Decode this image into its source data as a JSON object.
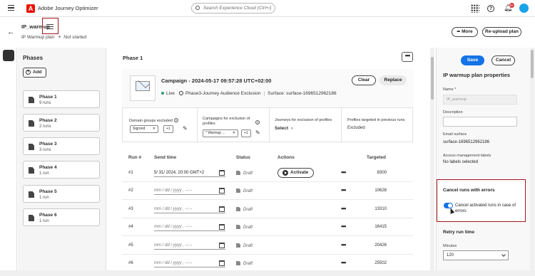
{
  "topbar": {
    "app_name": "Adobe Journey Optimizer",
    "search_placeholder": "Search Experience Cloud (Ctrl+/)",
    "notification_count": "9+",
    "brand_color": "#eb1000"
  },
  "header": {
    "title": "IP_warmup",
    "plan_label": "IP Warmup plan",
    "status": "Not started",
    "more_label": "More",
    "reupload_label": "Re-upload plan"
  },
  "phases_panel": {
    "title": "Phases",
    "add_label": "Add",
    "items": [
      {
        "name": "Phase 1",
        "runs": "9 runs"
      },
      {
        "name": "Phase 2",
        "runs": "2 runs"
      },
      {
        "name": "Phase 3",
        "runs": "3 runs"
      },
      {
        "name": "Phase 4",
        "runs": "1 run"
      },
      {
        "name": "Phase 5",
        "runs": "1 run"
      },
      {
        "name": "Phase 6",
        "runs": "1 run"
      }
    ]
  },
  "phase": {
    "title": "Phase 1",
    "campaign": {
      "name": "Campaign - 2024-05-17 09:57:28 UTC+02:00",
      "status": "Live",
      "audience": "Phase3-Journey Audience Exclusion",
      "surface": "Surface: surface-1696512962186",
      "clear_label": "Clear",
      "replace_label": "Replace"
    },
    "exclusions": {
      "domain_groups_label": "Domain groups excluded",
      "domain_tag": "Sigrond",
      "domain_more": "+1",
      "campaigns_label": "Campaigns for exclusion of profiles",
      "campaign_tag": "* Warmup ...",
      "campaign_more": "+1",
      "journeys_label": "Journeys for exclusion of profiles",
      "journeys_value": "Select",
      "profiles_label": "Profiles targeted in previous runs",
      "profiles_value": "Excluded"
    },
    "table": {
      "headers": {
        "run": "Run #",
        "send_time": "Send time",
        "status": "Status",
        "actions": "Actions",
        "targeted": "Targeted"
      },
      "activate_label": "Activate",
      "rows": [
        {
          "run": "#1",
          "send_time": "5/ 31/ 2024, 20:00 GMT+2",
          "status": "Draft",
          "targeted": "8300",
          "activate": true
        },
        {
          "run": "#2",
          "send_time": "mm / dd / yyyy , --:--",
          "status": "Draft",
          "targeted": "10628",
          "activate": false
        },
        {
          "run": "#3",
          "send_time": "mm / dd / yyyy , --:--",
          "status": "Draft",
          "targeted": "13310",
          "activate": false
        },
        {
          "run": "#4",
          "send_time": "mm / dd / yyyy , --:--",
          "status": "Draft",
          "targeted": "16415",
          "activate": false
        },
        {
          "run": "#5",
          "send_time": "mm / dd / yyyy , --:--",
          "status": "Draft",
          "targeted": "20426",
          "activate": false
        },
        {
          "run": "#6",
          "send_time": "mm / dd / yyyy , --:--",
          "status": "Draft",
          "targeted": "25502",
          "activate": false
        }
      ]
    }
  },
  "properties": {
    "save_label": "Save",
    "cancel_label": "Cancel",
    "title": "IP warmup plan properties",
    "name_label": "Name *",
    "name_value": "IP_warmup",
    "description_label": "Description",
    "email_surface_label": "Email surface",
    "email_surface_value": "surface-1696512962186",
    "access_label": "Access management labels",
    "access_value": "No labels selected",
    "cancel_runs_title": "Cancel runs with errors",
    "cancel_runs_toggle": "Cancel activated runs in case of errors",
    "retry_title": "Retry run time",
    "minutes_label": "Minutes",
    "minutes_value": "120",
    "accent_color": "#1473e6"
  }
}
